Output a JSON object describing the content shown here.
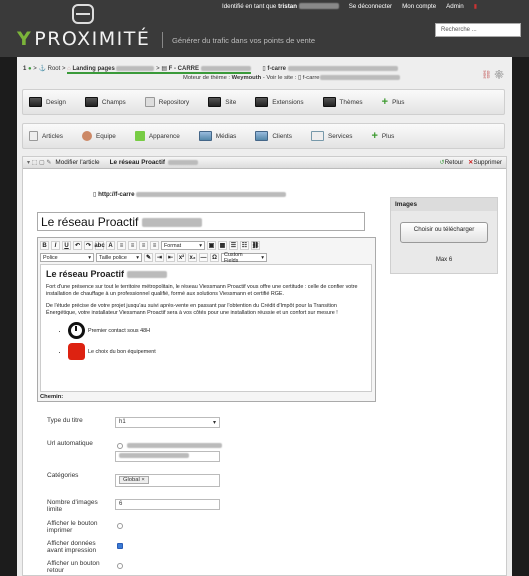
{
  "header": {
    "user_label": "Identifié en tant que",
    "user_name": "tristan",
    "logout": "Se déconnecter",
    "account": "Mon compte",
    "admin": "Admin",
    "brand": "PROXIMITÉ",
    "tagline": "Générer du trafic dans vos points de vente",
    "search_placeholder": "Recherche ..."
  },
  "breadcrumb": {
    "level": "1",
    "root": "Root",
    "landing": "Landing pages",
    "page": "F - CARRE",
    "file": "f-carre",
    "theme_label": "Moteur de thème :",
    "theme": "Weymouth",
    "site_label": "Voir le site :",
    "site_prefix": "f-carre"
  },
  "nav_top": [
    {
      "label": "Design"
    },
    {
      "label": "Champs"
    },
    {
      "label": "Repository"
    },
    {
      "label": "Site"
    },
    {
      "label": "Extensions"
    },
    {
      "label": "Thèmes"
    },
    {
      "label": "Plus"
    }
  ],
  "nav_second": [
    {
      "label": "Articles"
    },
    {
      "label": "Equipe"
    },
    {
      "label": "Apparence"
    },
    {
      "label": "Médias"
    },
    {
      "label": "Clients"
    },
    {
      "label": "Services"
    },
    {
      "label": "Plus"
    }
  ],
  "article": {
    "header_action": "Modifier l'article",
    "header_title": "Le réseau Proactif",
    "back": "Retour",
    "delete": "Supprimer",
    "url": "http://f-carre",
    "title_value": "Le réseau Proactif"
  },
  "editor": {
    "format_select": "Format",
    "font_select": "Police",
    "size_select": "Taille police",
    "custom_fields": "Custom Fields",
    "heading": "Le réseau Proactif",
    "para1": "Fort d'une présence sur tout le territoire métropolitain, le réseau Viessmann Proactif vous offre une certitude : celle de confier votre installation de chauffage à un professionnel qualifié, formé aux solutions Viessmann et certifié RGE.",
    "para2": "De l'étude précise de votre projet jusqu'au suivi après-vente en passant par l'obtention du Crédit d'Impôt pour la Transition Énergétique, votre installateur Viessmann Proactif sera à vos côtés pour une installation réussie et un confort sur mesure !",
    "item1": "Premier contact sous 48H",
    "item2": "Le choix du bon équipement",
    "path_label": "Chemin:"
  },
  "images_panel": {
    "title": "Images",
    "choose_button": "Choisir ou télécharger",
    "max_label": "Max 6"
  },
  "form": {
    "title_type_label": "Type du titre",
    "title_type_value": "h1",
    "auto_url_label": "Url automatique",
    "categories_label": "Catégories",
    "category_tag": "Global",
    "max_images_label": "Nombre d'images limite",
    "max_images_value": "6",
    "print_btn_label": "Afficher le bouton imprimer",
    "print_data_label": "Afficher données avant impression",
    "back_btn_label": "Afficher un bouton retour"
  },
  "colors": {
    "brand_green": "#7bb43a",
    "header_bg": "#3a3a3a"
  }
}
